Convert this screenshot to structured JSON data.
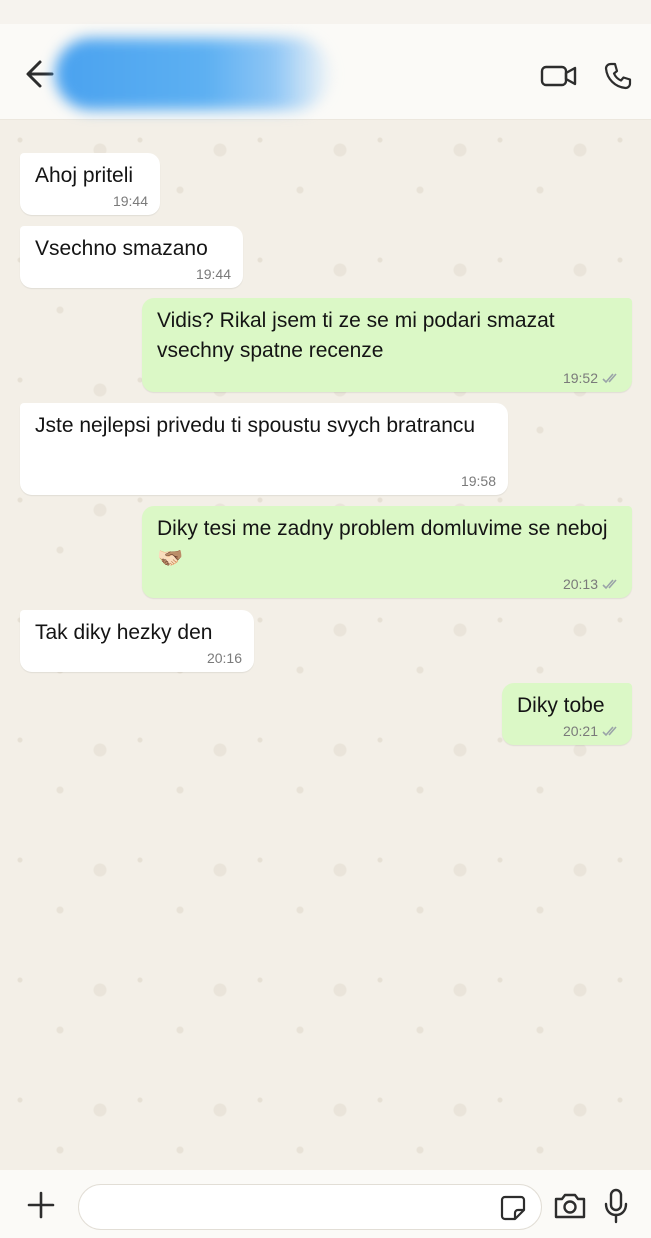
{
  "header": {
    "contact_name": "",
    "video_call_icon": "video-camera-icon",
    "voice_call_icon": "phone-icon",
    "back_icon": "back-arrow-icon"
  },
  "messages": [
    {
      "direction": "in",
      "text": "Ahoj priteli",
      "time": "19:44"
    },
    {
      "direction": "in",
      "text": "Vsechno smazano",
      "time": "19:44"
    },
    {
      "direction": "out",
      "text": "Vidis? Rikal jsem ti ze se mi podari smazat vsechny spatne recenze",
      "time": "19:52",
      "status": "read"
    },
    {
      "direction": "in",
      "text": "Jste nejlepsi privedu ti spoustu svych bratrancu",
      "time": "19:58"
    },
    {
      "direction": "out",
      "text": "Diky tesi me zadny problem domluvime se neboj",
      "emoji": "🫱🏻‍🫲🏽",
      "time": "20:13",
      "status": "read"
    },
    {
      "direction": "in",
      "text": "Tak diky hezky den",
      "time": "20:16"
    },
    {
      "direction": "out",
      "text": "Diky tobe",
      "time": "20:21",
      "status": "read"
    }
  ],
  "composer": {
    "placeholder": "",
    "attach_icon": "plus-icon",
    "sticker_icon": "sticker-icon",
    "camera_icon": "camera-icon",
    "mic_icon": "microphone-icon"
  },
  "colors": {
    "incoming_bubble": "#ffffff",
    "outgoing_bubble": "#dbf8c6",
    "chat_background": "#f3efe7",
    "header_background": "#fbfaf7",
    "read_tick": "#9aa3a8"
  }
}
